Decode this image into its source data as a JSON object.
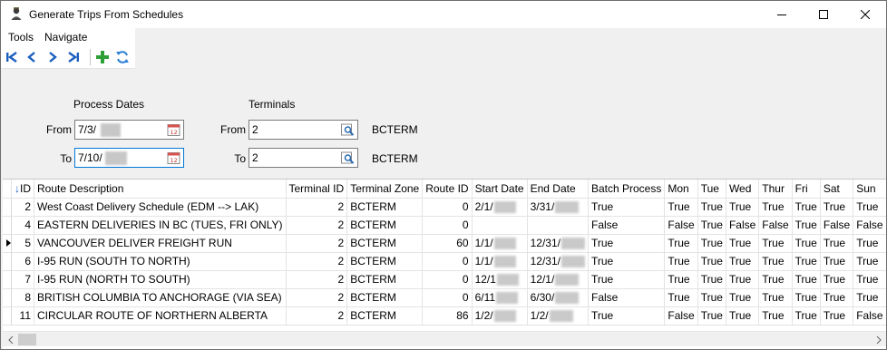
{
  "window": {
    "title": "Generate Trips From Schedules",
    "icons": {
      "app": "person-icon",
      "minimize": "minimize-icon",
      "maximize": "maximize-icon",
      "close": "close-icon"
    }
  },
  "menu": {
    "items": [
      "Tools",
      "Navigate"
    ]
  },
  "toolbar": {
    "icons": [
      "first-record-icon",
      "previous-record-icon",
      "next-record-icon",
      "last-record-icon",
      "add-icon",
      "refresh-icon"
    ],
    "colors": {
      "nav": "#1a5fc0",
      "add": "#2e9e36",
      "refresh": "#2b7fd4"
    }
  },
  "filters": {
    "process_dates": {
      "label": "Process Dates",
      "from_label": "From",
      "from_value": "7/3/",
      "to_label": "To",
      "to_value": "7/10/"
    },
    "terminals": {
      "label": "Terminals",
      "from_label": "From",
      "from_value": "2",
      "from_name": "BCTERM",
      "to_label": "To",
      "to_value": "2",
      "to_name": "BCTERM"
    }
  },
  "grid": {
    "sort_indicator": "↓",
    "columns": [
      "ID",
      "Route Description",
      "Terminal ID",
      "Terminal Zone",
      "Route ID",
      "Start Date",
      "End Date",
      "Batch Process",
      "Mon",
      "Tue",
      "Wed",
      "Thur",
      "Fri",
      "Sat",
      "Sun"
    ],
    "current_row": 2,
    "rows": [
      {
        "id": "2",
        "desc": "West Coast Delivery Schedule (EDM --> LAK)",
        "terminal_id": "2",
        "zone": "BCTERM",
        "route_id": "0",
        "start": "2/1/",
        "end": "3/31/",
        "batch": "True",
        "mon": "True",
        "tue": "True",
        "wed": "True",
        "thur": "True",
        "fri": "True",
        "sat": "True",
        "sun": "True"
      },
      {
        "id": "4",
        "desc": "EASTERN DELIVERIES IN BC (TUES, FRI ONLY)",
        "terminal_id": "2",
        "zone": "BCTERM",
        "route_id": "0",
        "start": "",
        "end": "",
        "batch": "False",
        "mon": "False",
        "tue": "True",
        "wed": "False",
        "thur": "False",
        "fri": "True",
        "sat": "False",
        "sun": "False"
      },
      {
        "id": "5",
        "desc": "VANCOUVER DELIVER FREIGHT RUN",
        "terminal_id": "2",
        "zone": "BCTERM",
        "route_id": "60",
        "start": "1/1/",
        "end": "12/31/",
        "batch": "True",
        "mon": "True",
        "tue": "True",
        "wed": "True",
        "thur": "True",
        "fri": "True",
        "sat": "True",
        "sun": "True"
      },
      {
        "id": "6",
        "desc": "I-95 RUN (SOUTH TO NORTH)",
        "terminal_id": "2",
        "zone": "BCTERM",
        "route_id": "0",
        "start": "1/1/",
        "end": "12/31/",
        "batch": "True",
        "mon": "True",
        "tue": "True",
        "wed": "True",
        "thur": "True",
        "fri": "True",
        "sat": "True",
        "sun": "True"
      },
      {
        "id": "7",
        "desc": "I-95 RUN (NORTH TO SOUTH)",
        "terminal_id": "2",
        "zone": "BCTERM",
        "route_id": "0",
        "start": "12/1",
        "end": "12/1/",
        "batch": "True",
        "mon": "True",
        "tue": "True",
        "wed": "True",
        "thur": "True",
        "fri": "True",
        "sat": "True",
        "sun": "True"
      },
      {
        "id": "8",
        "desc": "BRITISH COLUMBIA TO ANCHORAGE (VIA SEA)",
        "terminal_id": "2",
        "zone": "BCTERM",
        "route_id": "0",
        "start": "6/11",
        "end": "6/30/",
        "batch": "False",
        "mon": "True",
        "tue": "True",
        "wed": "True",
        "thur": "True",
        "fri": "True",
        "sat": "True",
        "sun": "True"
      },
      {
        "id": "11",
        "desc": "CIRCULAR ROUTE OF NORTHERN ALBERTA",
        "terminal_id": "2",
        "zone": "BCTERM",
        "route_id": "86",
        "start": "1/2/",
        "end": "1/2/",
        "batch": "True",
        "mon": "False",
        "tue": "True",
        "wed": "True",
        "thur": "True",
        "fri": "True",
        "sat": "True",
        "sun": "False"
      }
    ]
  }
}
